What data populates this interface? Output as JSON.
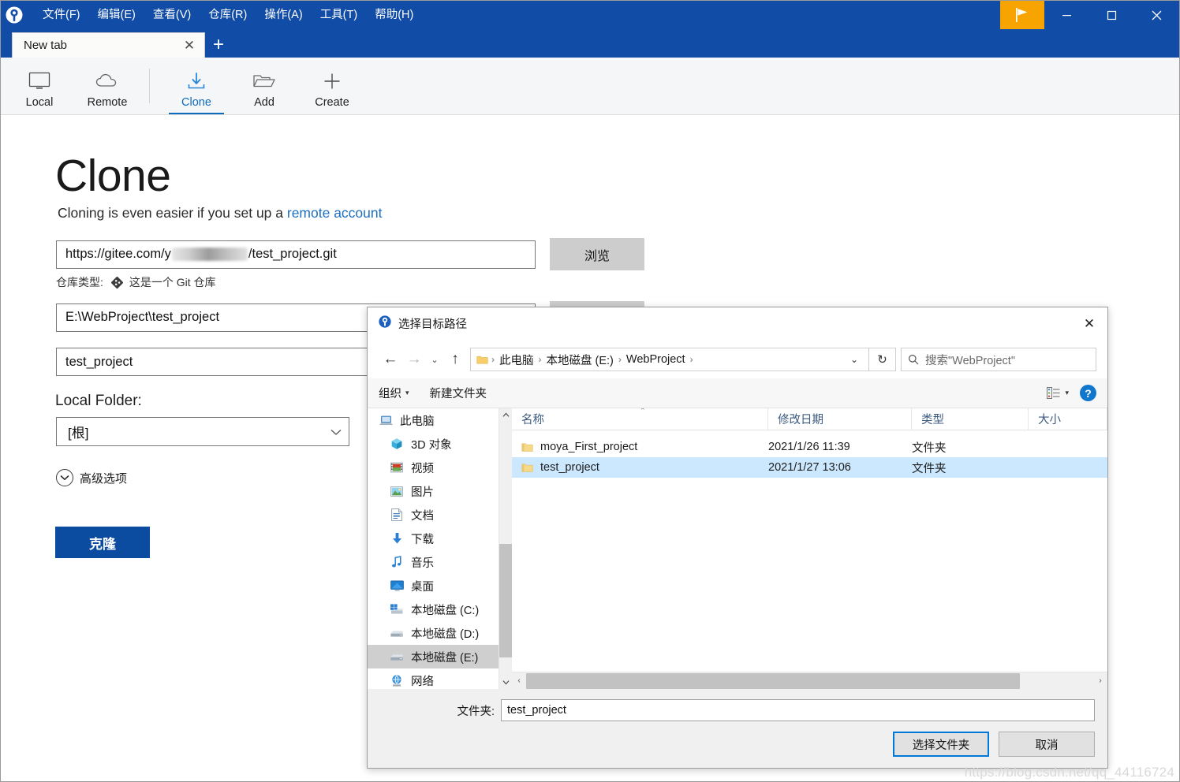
{
  "window": {
    "menu": [
      "文件(F)",
      "编辑(E)",
      "查看(V)",
      "仓库(R)",
      "操作(A)",
      "工具(T)",
      "帮助(H)"
    ],
    "minimize": "—",
    "maximize": "▢",
    "close": "✕"
  },
  "tabs": {
    "items": [
      {
        "label": "New tab",
        "close": "✕"
      }
    ],
    "new_tab": "+"
  },
  "toolbar": {
    "items": [
      {
        "label": "Local",
        "icon": "monitor-icon"
      },
      {
        "label": "Remote",
        "icon": "cloud-icon"
      },
      {
        "label": "Clone",
        "icon": "download-icon"
      },
      {
        "label": "Add",
        "icon": "folder-open-icon"
      },
      {
        "label": "Create",
        "icon": "plus-icon"
      }
    ]
  },
  "clone_page": {
    "title": "Clone",
    "subtitle_prefix": "Cloning is even easier if you set up a ",
    "subtitle_link": "remote account",
    "url_prefix": "https://gitee.com/y",
    "url_suffix": "/test_project.git",
    "browse_label": "浏览",
    "repo_type_label": "仓库类型:",
    "repo_type_value": "这是一个 Git 仓库",
    "path_value": "E:\\WebProject\\test_project",
    "name_value": "test_project",
    "local_folder_label": "Local Folder:",
    "local_folder_value": "[根]",
    "advanced_label": "高级选项",
    "clone_button": "克隆"
  },
  "dialog": {
    "title": "选择目标路径",
    "close": "✕",
    "nav": {
      "back": "←",
      "forward": "→",
      "history": "⌄",
      "up": "↑",
      "breadcrumbs": [
        "此电脑",
        "本地磁盘 (E:)",
        "WebProject"
      ],
      "separator": "›",
      "dropdown": "⌄",
      "refresh": "↻",
      "search_placeholder": "搜索\"WebProject\""
    },
    "toolbar": {
      "organize": "组织",
      "organize_caret": "▾",
      "new_folder": "新建文件夹",
      "view_caret": "▾",
      "help": "?"
    },
    "tree": [
      {
        "label": "此电脑",
        "icon": "computer-icon",
        "selected": false
      },
      {
        "label": "3D 对象",
        "icon": "3d-object-icon",
        "selected": false
      },
      {
        "label": "视频",
        "icon": "videos-icon",
        "selected": false
      },
      {
        "label": "图片",
        "icon": "pictures-icon",
        "selected": false
      },
      {
        "label": "文档",
        "icon": "documents-icon",
        "selected": false
      },
      {
        "label": "下载",
        "icon": "downloads-icon",
        "selected": false
      },
      {
        "label": "音乐",
        "icon": "music-icon",
        "selected": false
      },
      {
        "label": "桌面",
        "icon": "desktop-icon",
        "selected": false
      },
      {
        "label": "本地磁盘 (C:)",
        "icon": "windows-drive-icon",
        "selected": false
      },
      {
        "label": "本地磁盘 (D:)",
        "icon": "drive-icon",
        "selected": false
      },
      {
        "label": "本地磁盘 (E:)",
        "icon": "drive-icon",
        "selected": true
      },
      {
        "label": "网络",
        "icon": "network-icon",
        "selected": false
      }
    ],
    "columns": [
      "名称",
      "修改日期",
      "类型",
      "大小"
    ],
    "rows": [
      {
        "name": "moya_First_project",
        "date": "2021/1/26 11:39",
        "type": "文件夹",
        "size": "",
        "selected": false
      },
      {
        "name": "test_project",
        "date": "2021/1/27 13:06",
        "type": "文件夹",
        "size": "",
        "selected": true
      }
    ],
    "footer": {
      "folder_label": "文件夹:",
      "folder_value": "test_project",
      "select_button": "选择文件夹",
      "cancel_button": "取消"
    }
  },
  "watermark": "https://blog.csdn.net/qq_44116724"
}
